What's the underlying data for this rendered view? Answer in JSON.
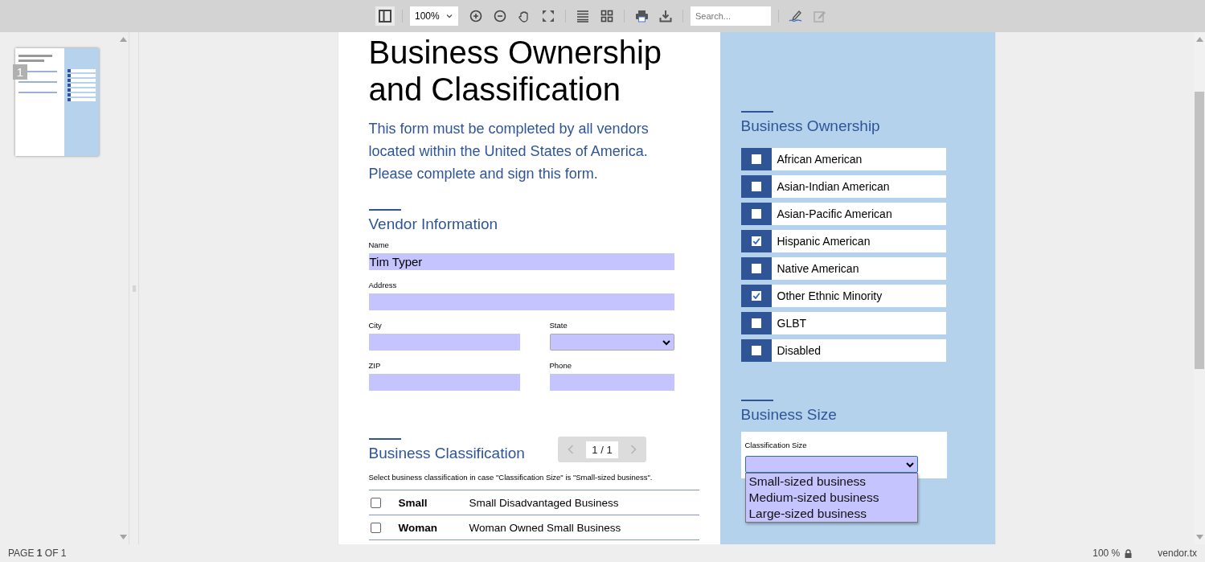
{
  "toolbar": {
    "sidebar_toggle": {
      "active": true
    },
    "zoom": {
      "value": "100%"
    },
    "search": {
      "placeholder": "Search..."
    },
    "edit": {
      "disabled": true
    }
  },
  "sidebar": {
    "thumbnails": [
      {
        "label": "1",
        "selected": true
      }
    ]
  },
  "document": {
    "title": "Business Ownership and Classification",
    "intro": "This form must be completed by all vendors located within the United States of America. Please complete and sign this form.",
    "vendor_information": {
      "heading": "Vendor Information",
      "fields": [
        {
          "label": "Name",
          "kind": "text",
          "value": "Tim Typer"
        },
        {
          "label": "Address",
          "kind": "text"
        },
        {
          "label": "City",
          "kind": "text"
        },
        {
          "label": "State",
          "kind": "select"
        },
        {
          "label": "ZIP",
          "kind": "text"
        },
        {
          "label": "Phone",
          "kind": "text"
        }
      ]
    },
    "business_classification": {
      "heading": "Business Classification",
      "note": "Select business classification in case \"Classification Size\" is \"Small-sized business\".",
      "rows": [
        {
          "checked": false,
          "code": "Small",
          "description": "Small Disadvantaged Business"
        },
        {
          "checked": false,
          "code": "Woman",
          "description": "Woman Owned Small Business"
        }
      ]
    },
    "business_ownership": {
      "heading": "Business Ownership",
      "items": [
        {
          "label": "African American",
          "checked": false
        },
        {
          "label": "Asian-Indian American",
          "checked": false
        },
        {
          "label": "Asian-Pacific American",
          "checked": false
        },
        {
          "label": "Hispanic American",
          "checked": true
        },
        {
          "label": "Native American",
          "checked": false
        },
        {
          "label": "Other Ethnic Minority",
          "checked": true
        },
        {
          "label": "GLBT",
          "checked": false
        },
        {
          "label": "Disabled",
          "checked": false
        }
      ]
    },
    "business_size": {
      "heading": "Business Size",
      "field": {
        "label": "Classification Size",
        "expanded": true,
        "options": [
          {
            "label": "Small-sized business",
            "selected": false
          },
          {
            "label": "Medium-sized business",
            "selected": false
          },
          {
            "label": "Large-sized business",
            "selected": false
          }
        ]
      }
    }
  },
  "pager": {
    "current": "1 / 1"
  },
  "status_bar": {
    "page": "PAGE **1** OF 1",
    "zoom": "100 %",
    "locked": true,
    "file": "vendor.tx"
  }
}
